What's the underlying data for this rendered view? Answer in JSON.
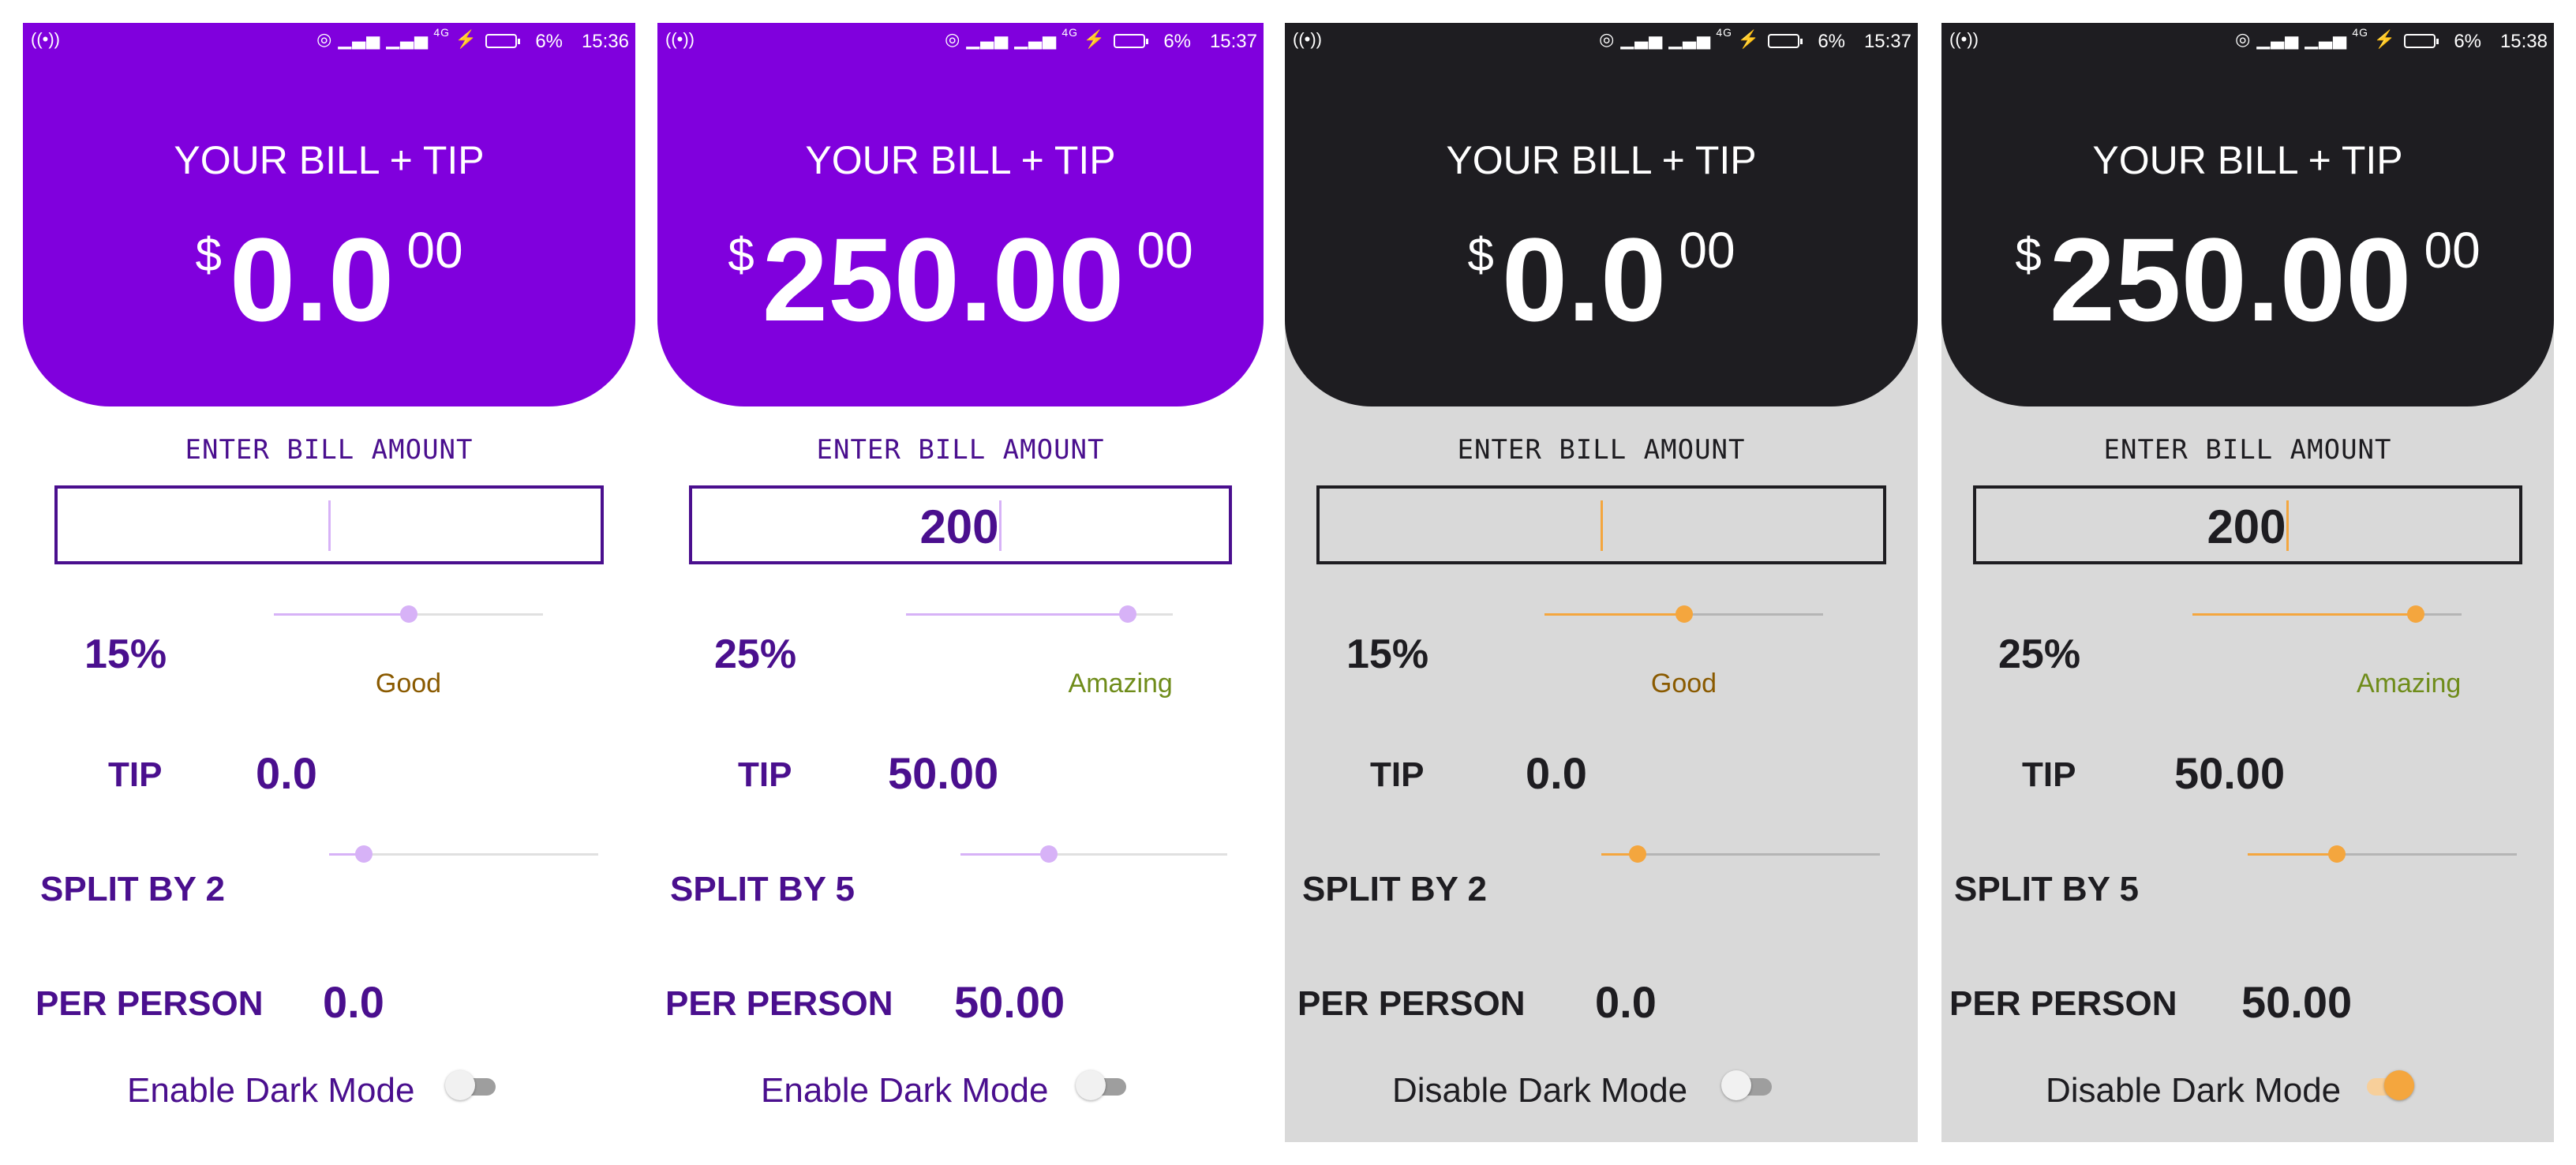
{
  "colors": {
    "light_header": "#8000DD",
    "dark_header": "#1E1D21",
    "light_text": "#4A0F8E",
    "dark_text": "#1E1D21",
    "light_accent": "#D7B2F7",
    "dark_accent": "#F4A63E",
    "good": "#8A5A00",
    "amazing": "#6F8C1A",
    "dark_bg": "#D9D9D9"
  },
  "status_icons": [
    "wifi-hotspot-icon",
    "4g-signal-icon",
    "charging-icon",
    "battery-icon"
  ],
  "screens": [
    {
      "theme": "light",
      "status": {
        "time": "15:36",
        "battery": "6%",
        "network": "4G"
      },
      "header": {
        "title": "YOUR BILL + TIP",
        "currency": "$",
        "total": "0.0",
        "cents": "00"
      },
      "bill": {
        "label": "ENTER BILL AMOUNT",
        "value": ""
      },
      "tip_percent": {
        "label": "15%",
        "value": 15,
        "slider_fraction": 0.5,
        "rating": "Good"
      },
      "tip": {
        "label": "TIP",
        "value": "0.0"
      },
      "split": {
        "label": "SPLIT BY 2",
        "value": 2,
        "slider_fraction": 0.13
      },
      "per_person": {
        "label": "PER PERSON",
        "value": "0.0"
      },
      "dark_mode": {
        "label": "Enable Dark Mode",
        "enabled": false
      }
    },
    {
      "theme": "light",
      "status": {
        "time": "15:37",
        "battery": "6%",
        "network": "4G"
      },
      "header": {
        "title": "YOUR BILL + TIP",
        "currency": "$",
        "total": "250.00",
        "cents": "00"
      },
      "bill": {
        "label": "ENTER BILL AMOUNT",
        "value": "200"
      },
      "tip_percent": {
        "label": "25%",
        "value": 25,
        "slider_fraction": 0.83,
        "rating": "Amazing"
      },
      "tip": {
        "label": "TIP",
        "value": "50.00"
      },
      "split": {
        "label": "SPLIT BY 5",
        "value": 5,
        "slider_fraction": 0.33
      },
      "per_person": {
        "label": "PER PERSON",
        "value": "50.00"
      },
      "dark_mode": {
        "label": "Enable Dark Mode",
        "enabled": false
      }
    },
    {
      "theme": "dark",
      "status": {
        "time": "15:37",
        "battery": "6%",
        "network": "4G"
      },
      "header": {
        "title": "YOUR BILL + TIP",
        "currency": "$",
        "total": "0.0",
        "cents": "00"
      },
      "bill": {
        "label": "ENTER BILL AMOUNT",
        "value": ""
      },
      "tip_percent": {
        "label": "15%",
        "value": 15,
        "slider_fraction": 0.5,
        "rating": "Good"
      },
      "tip": {
        "label": "TIP",
        "value": "0.0"
      },
      "split": {
        "label": "SPLIT BY 2",
        "value": 2,
        "slider_fraction": 0.13
      },
      "per_person": {
        "label": "PER PERSON",
        "value": "0.0"
      },
      "dark_mode": {
        "label": "Disable Dark Mode",
        "enabled": false
      }
    },
    {
      "theme": "dark",
      "status": {
        "time": "15:38",
        "battery": "6%",
        "network": "4G"
      },
      "header": {
        "title": "YOUR BILL + TIP",
        "currency": "$",
        "total": "250.00",
        "cents": "00"
      },
      "bill": {
        "label": "ENTER BILL AMOUNT",
        "value": "200"
      },
      "tip_percent": {
        "label": "25%",
        "value": 25,
        "slider_fraction": 0.83,
        "rating": "Amazing"
      },
      "tip": {
        "label": "TIP",
        "value": "50.00"
      },
      "split": {
        "label": "SPLIT BY 5",
        "value": 5,
        "slider_fraction": 0.33
      },
      "per_person": {
        "label": "PER PERSON",
        "value": "50.00"
      },
      "dark_mode": {
        "label": "Disable Dark Mode",
        "enabled": true
      }
    }
  ]
}
